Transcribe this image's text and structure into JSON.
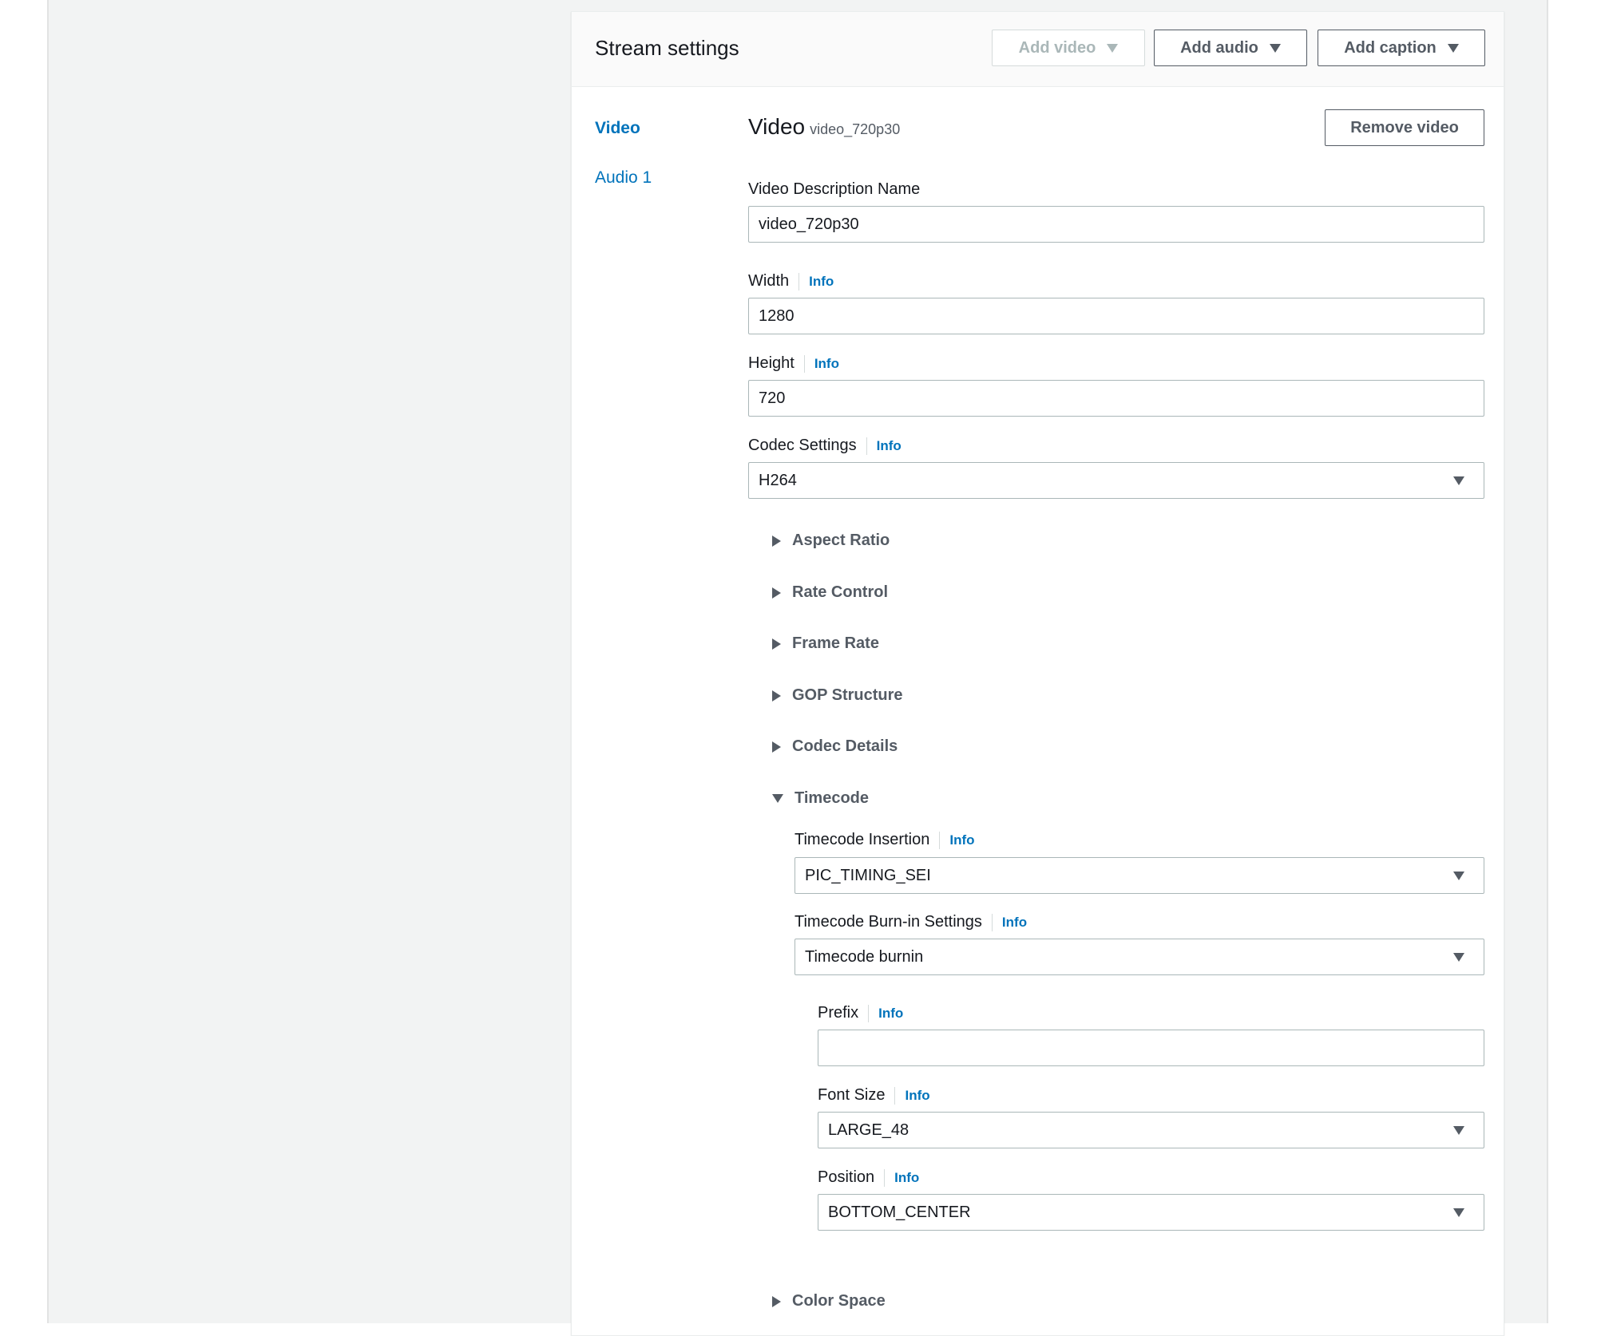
{
  "header": {
    "title": "Stream settings",
    "add_video": "Add video",
    "add_audio": "Add audio",
    "add_caption": "Add caption"
  },
  "nav": {
    "items": [
      {
        "label": "Video",
        "active": true
      },
      {
        "label": "Audio 1",
        "active": false
      }
    ]
  },
  "video": {
    "title": "Video",
    "subtitle": "video_720p30",
    "remove_label": "Remove video",
    "description_name": {
      "label": "Video Description Name",
      "value": "video_720p30"
    },
    "width": {
      "label": "Width",
      "info": "Info",
      "value": "1280"
    },
    "height": {
      "label": "Height",
      "info": "Info",
      "value": "720"
    },
    "codec": {
      "label": "Codec Settings",
      "info": "Info",
      "value": "H264"
    }
  },
  "sections": {
    "aspect_ratio": "Aspect Ratio",
    "rate_control": "Rate Control",
    "frame_rate": "Frame Rate",
    "gop_structure": "GOP Structure",
    "codec_details": "Codec Details",
    "timecode": "Timecode",
    "color_space": "Color Space"
  },
  "timecode": {
    "insertion": {
      "label": "Timecode Insertion",
      "info": "Info",
      "value": "PIC_TIMING_SEI"
    },
    "burnin": {
      "label": "Timecode Burn-in Settings",
      "info": "Info",
      "value": "Timecode burnin"
    },
    "prefix": {
      "label": "Prefix",
      "info": "Info",
      "value": ""
    },
    "font_size": {
      "label": "Font Size",
      "info": "Info",
      "value": "LARGE_48"
    },
    "position": {
      "label": "Position",
      "info": "Info",
      "value": "BOTTOM_CENTER"
    }
  },
  "colors": {
    "link": "#0073bb",
    "text": "#16191f",
    "muted": "#545b64",
    "border": "#aab7b8",
    "page_bg": "#f2f3f3"
  }
}
